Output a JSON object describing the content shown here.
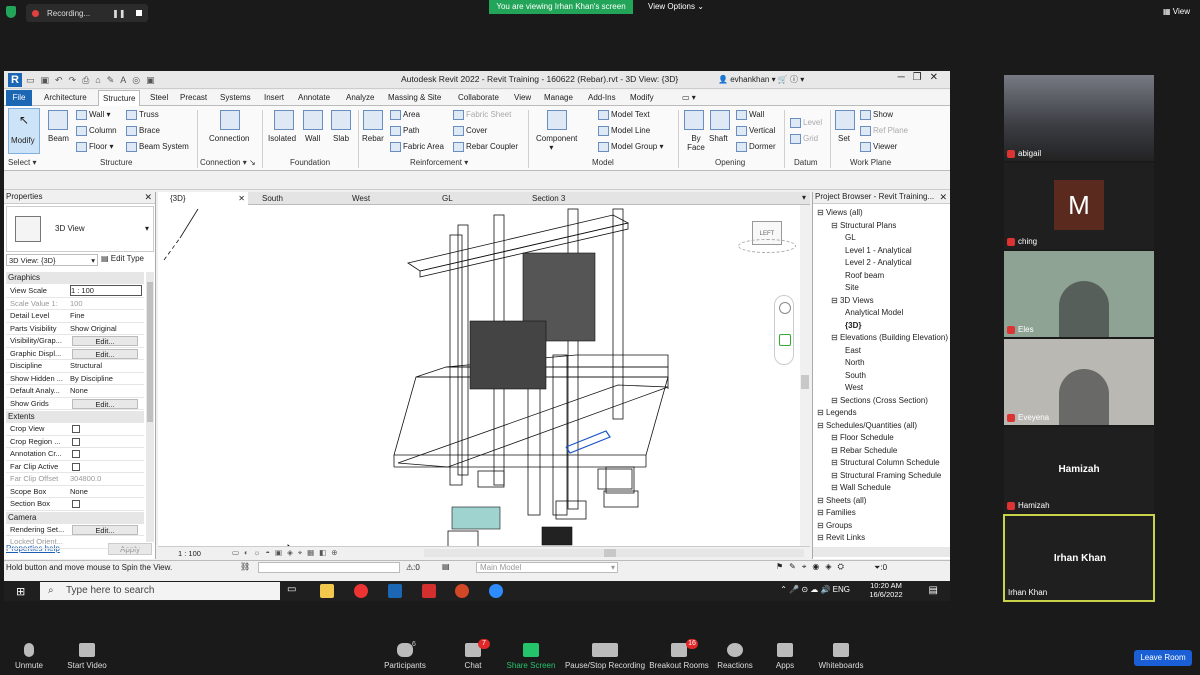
{
  "zoom_top": {
    "recording_label": "Recording...",
    "viewing_banner": "You are viewing Irhan Khan's screen",
    "view_options_label": "View Options",
    "view_label": "View"
  },
  "revit": {
    "title": "Autodesk Revit 2022 - Revit Training - 160622 (Rebar).rvt - 3D View: {3D}",
    "user": "evhankhan",
    "tabs": [
      "File",
      "Architecture",
      "Structure",
      "Steel",
      "Precast",
      "Systems",
      "Insert",
      "Annotate",
      "Analyze",
      "Massing & Site",
      "Collaborate",
      "View",
      "Manage",
      "Add-Ins",
      "Modify"
    ],
    "active_tab": "Structure",
    "ribbon": {
      "modify": "Modify",
      "select": "Select",
      "beam": "Beam",
      "wall": "Wall",
      "column": "Column",
      "floor": "Floor",
      "truss": "Truss",
      "brace": "Brace",
      "beam_system": "Beam  System",
      "structure_panel": "Structure",
      "connection": "Connection",
      "connection_panel": "Connection",
      "isolated": "Isolated",
      "wall_f": "Wall",
      "slab": "Slab",
      "foundation_panel": "Foundation",
      "rebar": "Rebar",
      "area": "Area",
      "path": "Path",
      "fabric_area": "Fabric  Area",
      "fabric_sheet": "Fabric  Sheet",
      "cover": "Cover",
      "rebar_coupler": "Rebar  Coupler",
      "reinforcement_panel": "Reinforcement",
      "component": "Component",
      "model_text": "Model  Text",
      "model_line": "Model  Line",
      "model_group": "Model  Group",
      "model_panel": "Model",
      "by_face": "By Face",
      "shaft": "Shaft",
      "wall_o": "Wall",
      "vertical": "Vertical",
      "dormer": "Dormer",
      "opening_panel": "Opening",
      "level": "Level",
      "grid": "Grid",
      "datum_panel": "Datum",
      "set": "Set",
      "show": "Show",
      "ref_plane": "Ref  Plane",
      "viewer": "Viewer",
      "workplane_panel": "Work Plane"
    },
    "properties": {
      "title": "Properties",
      "type_name": "3D View",
      "instance_selector": "3D View: {3D}",
      "edit_type": "Edit Type",
      "sections": {
        "graphics": "Graphics",
        "extents": "Extents",
        "camera": "Camera"
      },
      "graphics_rows": [
        {
          "k": "View Scale",
          "v": "1 : 100"
        },
        {
          "k": "Scale Value   1:",
          "v": "100"
        },
        {
          "k": "Detail Level",
          "v": "Fine"
        },
        {
          "k": "Parts Visibility",
          "v": "Show Original"
        },
        {
          "k": "Visibility/Grap...",
          "v": "Edit..."
        },
        {
          "k": "Graphic Displ...",
          "v": "Edit..."
        },
        {
          "k": "Discipline",
          "v": "Structural"
        },
        {
          "k": "Show Hidden ...",
          "v": "By Discipline"
        },
        {
          "k": "Default Analy...",
          "v": "None"
        },
        {
          "k": "Show Grids",
          "v": "Edit..."
        }
      ],
      "extents_rows": [
        {
          "k": "Crop View",
          "v": ""
        },
        {
          "k": "Crop Region ...",
          "v": ""
        },
        {
          "k": "Annotation Cr...",
          "v": ""
        },
        {
          "k": "Far Clip Active",
          "v": ""
        },
        {
          "k": "Far Clip Offset",
          "v": "304800.0"
        },
        {
          "k": "Scope Box",
          "v": "None"
        },
        {
          "k": "Section Box",
          "v": ""
        }
      ],
      "camera_rows": [
        {
          "k": "Rendering Set...",
          "v": "Edit..."
        },
        {
          "k": "Locked Orient...",
          "v": ""
        }
      ],
      "help_link": "Properties help",
      "apply": "Apply"
    },
    "view_tabs": [
      "{3D}",
      "South",
      "West",
      "GL",
      "Section 3"
    ],
    "view_scale": "1 : 100",
    "viewcube_label": "LEFT",
    "project_browser": {
      "title": "Project Browser - Revit Training...",
      "items": [
        {
          "label": "Views (all)",
          "level": 0
        },
        {
          "label": "Structural Plans",
          "level": 1
        },
        {
          "label": "GL",
          "level": 2
        },
        {
          "label": "Level 1 - Analytical",
          "level": 2
        },
        {
          "label": "Level 2 - Analytical",
          "level": 2
        },
        {
          "label": "Roof beam",
          "level": 2
        },
        {
          "label": "Site",
          "level": 2
        },
        {
          "label": "3D Views",
          "level": 1
        },
        {
          "label": "Analytical Model",
          "level": 2
        },
        {
          "label": "{3D}",
          "level": 2
        },
        {
          "label": "Elevations (Building Elevation)",
          "level": 1
        },
        {
          "label": "East",
          "level": 2
        },
        {
          "label": "North",
          "level": 2
        },
        {
          "label": "South",
          "level": 2
        },
        {
          "label": "West",
          "level": 2
        },
        {
          "label": "Sections (Cross Section)",
          "level": 1
        },
        {
          "label": "Legends",
          "level": 0
        },
        {
          "label": "Schedules/Quantities (all)",
          "level": 0
        },
        {
          "label": "Floor Schedule",
          "level": 1
        },
        {
          "label": "Rebar Schedule",
          "level": 1
        },
        {
          "label": "Structural Column Schedule",
          "level": 1
        },
        {
          "label": "Structural Framing Schedule",
          "level": 1
        },
        {
          "label": "Wall Schedule",
          "level": 1
        },
        {
          "label": "Sheets (all)",
          "level": 0
        },
        {
          "label": "Families",
          "level": 0
        },
        {
          "label": "Groups",
          "level": 0
        },
        {
          "label": "Revit Links",
          "level": 0
        }
      ]
    },
    "status": {
      "hint": "Hold button and move mouse to Spin the View.",
      "zero1": ":0",
      "model": "Main Model",
      "zero2": ":0"
    }
  },
  "taskbar": {
    "search_placeholder": "Type here to search",
    "lang": "ENG",
    "time": "10:20 AM",
    "date": "16/6/2022"
  },
  "participants": [
    {
      "name": "abigail",
      "type": "image",
      "bg": "#6b6d74"
    },
    {
      "name": "ching",
      "type": "avatar",
      "initial": "M",
      "bg": "#1f1f1f"
    },
    {
      "name": "Eles",
      "type": "image",
      "bg": "#8ea394"
    },
    {
      "name": "Eveyena",
      "type": "image",
      "bg": "#b9b8b3"
    },
    {
      "name": "Hamizah",
      "type": "name",
      "bg": "#1f1f1f"
    },
    {
      "name": "Irhan Khan",
      "type": "name",
      "bg": "#1f1f1f",
      "active": true
    }
  ],
  "zoom_bottom": {
    "unmute": "Unmute",
    "start_video": "Start Video",
    "participants": "Participants",
    "participants_count": "6",
    "chat": "Chat",
    "chat_badge": "7",
    "share_screen": "Share Screen",
    "pause_recording": "Pause/Stop Recording",
    "breakout_rooms": "Breakout Rooms",
    "breakout_badge": "16",
    "reactions": "Reactions",
    "apps": "Apps",
    "whiteboards": "Whiteboards",
    "leave": "Leave Room"
  },
  "colors": {
    "banner_green": "#23a559",
    "revit_blue": "#1b67b4",
    "active_border": "#c9d34a",
    "leave_blue": "#1a5fd6"
  }
}
